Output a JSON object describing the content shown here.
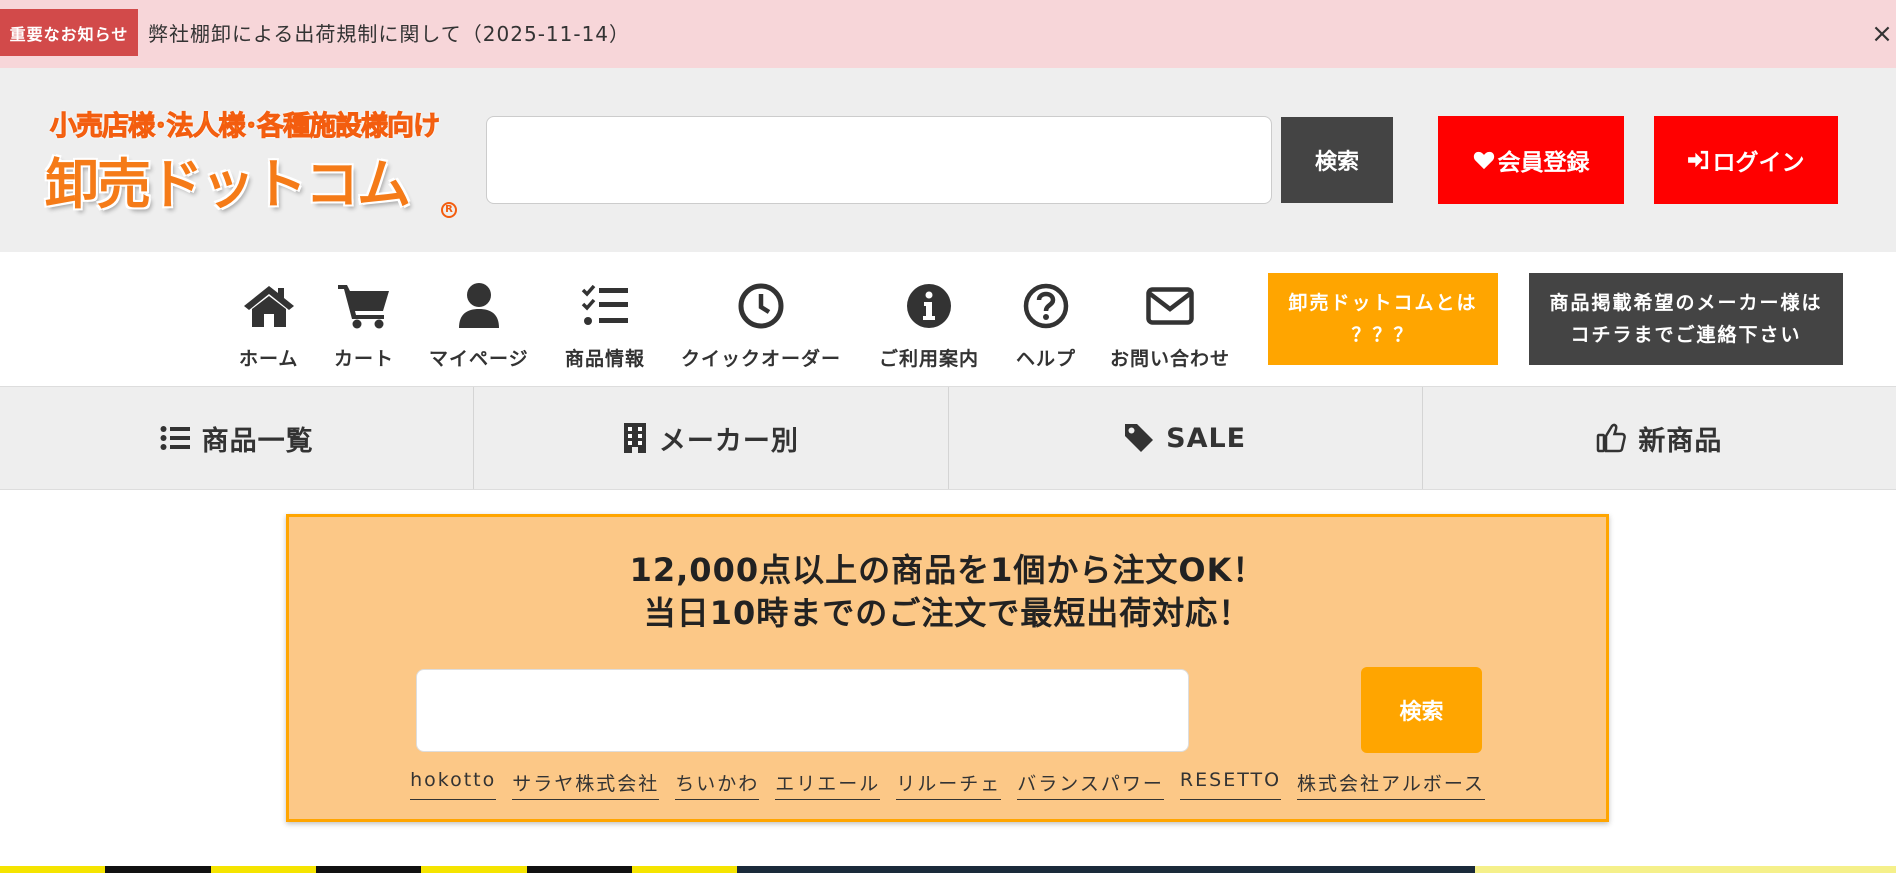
{
  "notice": {
    "badge": "重要なお知らせ",
    "text": "弊社棚卸による出荷規制に関して（2025-11-14）",
    "close": "×"
  },
  "header": {
    "logo_subtitle": "小売店様･法人様･各種施設様向け",
    "logo_main": "卸売ドットコム",
    "search_placeholder": "",
    "search_button": "検索",
    "register_button": "会員登録",
    "login_button": "ログイン"
  },
  "nav": {
    "items": [
      {
        "label": "ホーム",
        "icon": "home-icon"
      },
      {
        "label": "カート",
        "icon": "cart-icon"
      },
      {
        "label": "マイページ",
        "icon": "user-icon"
      },
      {
        "label": "商品情報",
        "icon": "checklist-icon"
      },
      {
        "label": "クイックオーダー",
        "icon": "clock-icon"
      },
      {
        "label": "ご利用案内",
        "icon": "info-icon"
      },
      {
        "label": "ヘルプ",
        "icon": "help-icon"
      },
      {
        "label": "お問い合わせ",
        "icon": "mail-icon"
      }
    ],
    "about_line1": "卸売ドットコムとは",
    "about_line2": "？？？",
    "maker_line1": "商品掲載希望のメーカー様は",
    "maker_line2": "コチラまでご連絡下さい"
  },
  "categories": [
    {
      "label": "商品一覧",
      "icon": "list-icon"
    },
    {
      "label": "メーカー別",
      "icon": "building-icon"
    },
    {
      "label": "SALE",
      "icon": "tag-icon"
    },
    {
      "label": "新商品",
      "icon": "thumbs-up-icon"
    }
  ],
  "promo": {
    "line1": "12,000点以上の商品を1個から注文OK！",
    "line2": "当日10時までのご注文で最短出荷対応！",
    "search_placeholder": "",
    "search_button": "検索",
    "links": [
      "hokotto",
      "サラヤ株式会社",
      "ちいかわ",
      "エリエール",
      "リルーチェ",
      "バランスパワー",
      "RESETTO",
      "株式会社アルボース"
    ]
  },
  "colors": {
    "notice_bg": "#f7d6d9",
    "notice_badge": "#d24a4a",
    "header_bg": "#eeeeee",
    "accent_red": "#ff0000",
    "accent_orange": "#ffa500",
    "dark": "#444444",
    "promo_bg": "#fcc887"
  }
}
